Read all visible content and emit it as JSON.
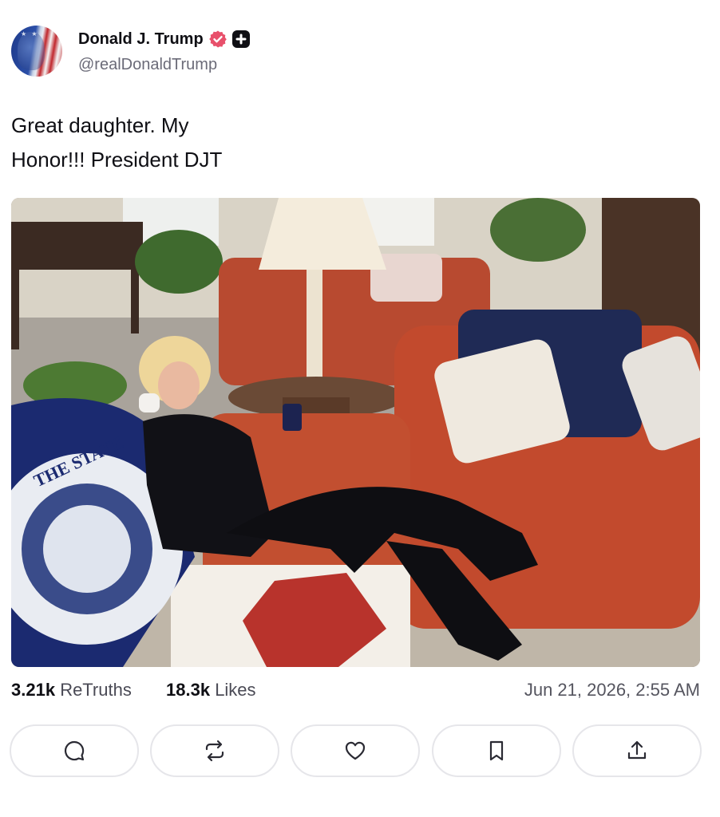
{
  "post": {
    "author_name": "Donald J. Trump",
    "author_handle": "@realDonaldTrump",
    "text_line1": "Great daughter. My",
    "text_line2": "Honor!!! President DJT"
  },
  "stats": {
    "retruths_count": "3.21k",
    "retruths_label": "ReTruths",
    "likes_count": "18.3k",
    "likes_label": "Likes",
    "timestamp": "Jun 21, 2026, 2:55 AM"
  },
  "icons": {
    "verified": "verified-badge-icon",
    "plus": "plus-badge-icon",
    "reply": "reply-bubble-icon",
    "retruth": "repost-arrows-icon",
    "like": "heart-icon",
    "bookmark": "bookmark-icon",
    "share": "share-upload-icon"
  },
  "colors": {
    "verified_badge": "#e8506b",
    "text_primary": "#0f0f14",
    "text_secondary": "#6b6b78",
    "button_border": "#e6e6ea"
  },
  "image": {
    "alt": "Photo of a blonde woman in black sitting on a red sofa talking on a telephone, with a blue state-seal blanket and a lamp in the background"
  }
}
